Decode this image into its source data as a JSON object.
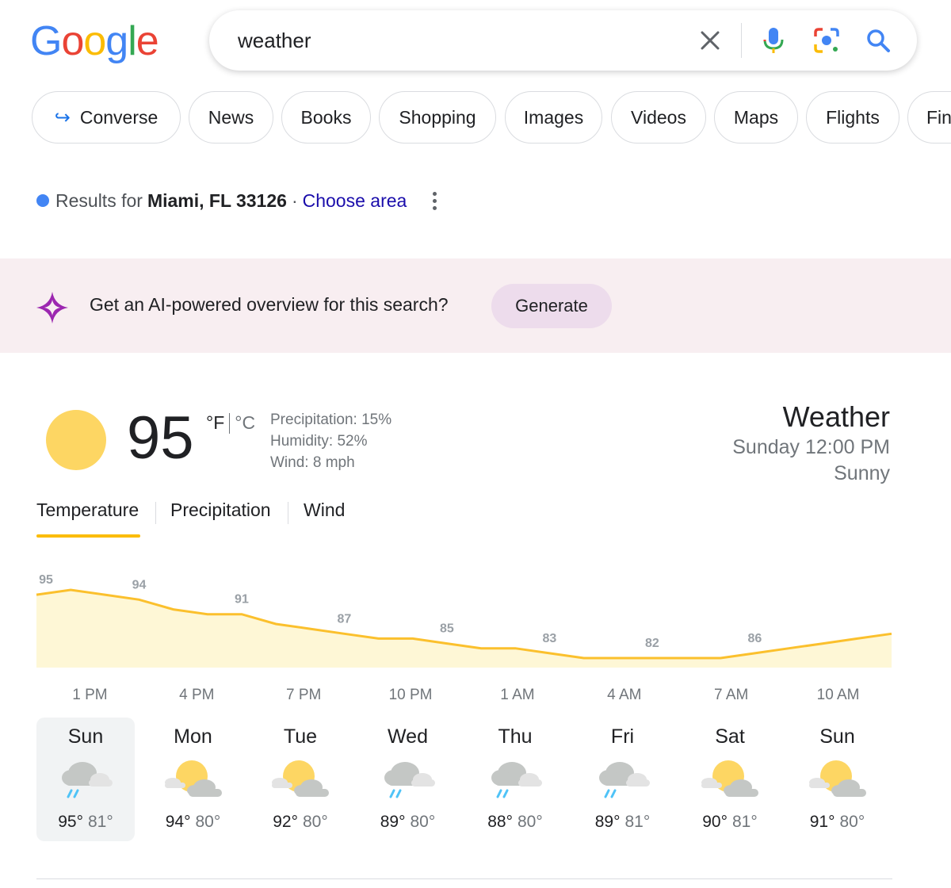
{
  "search": {
    "query": "weather"
  },
  "chips": [
    {
      "label": "Converse"
    },
    {
      "label": "News"
    },
    {
      "label": "Books"
    },
    {
      "label": "Shopping"
    },
    {
      "label": "Images"
    },
    {
      "label": "Videos"
    },
    {
      "label": "Maps"
    },
    {
      "label": "Flights"
    },
    {
      "label": "Fin"
    }
  ],
  "location": {
    "prefix": "Results for",
    "place": "Miami, FL 33126",
    "separator": "·",
    "choose": "Choose area"
  },
  "ai": {
    "prompt": "Get an AI-powered overview for this search?",
    "button": "Generate"
  },
  "weather": {
    "temp": "95",
    "unit_f": "°F",
    "unit_c": "°C",
    "precipitation": "Precipitation: 15%",
    "humidity": "Humidity: 52%",
    "wind": "Wind: 8 mph",
    "title": "Weather",
    "time": "Sunday 12:00 PM",
    "condition": "Sunny",
    "tabs": [
      "Temperature",
      "Precipitation",
      "Wind"
    ],
    "sun_color": "#fdd663",
    "accent": "#fbbc04"
  },
  "chart_data": {
    "type": "area",
    "hours": [
      "1 PM",
      "4 PM",
      "7 PM",
      "10 PM",
      "1 AM",
      "4 AM",
      "7 AM",
      "10 AM"
    ],
    "series_temps": [
      95,
      96,
      95,
      94,
      92,
      91,
      91,
      89,
      88,
      87,
      86,
      86,
      85,
      84,
      84,
      83,
      82,
      82,
      82,
      82,
      82,
      83,
      84,
      85,
      86,
      87
    ],
    "labels": [
      95,
      94,
      91,
      87,
      85,
      83,
      82,
      86
    ],
    "label_indices": [
      0,
      3,
      6,
      9,
      12,
      15,
      18,
      21
    ],
    "ylim": [
      70,
      100
    ],
    "line_color": "#fbc02d",
    "fill_color": "#fef7d6"
  },
  "days": [
    {
      "name": "Sun",
      "hi": "95°",
      "lo": "81°",
      "icon": "rain-cloud-icon",
      "selected": true
    },
    {
      "name": "Mon",
      "hi": "94°",
      "lo": "80°",
      "icon": "partly-sunny-icon"
    },
    {
      "name": "Tue",
      "hi": "92°",
      "lo": "80°",
      "icon": "partly-sunny-icon"
    },
    {
      "name": "Wed",
      "hi": "89°",
      "lo": "80°",
      "icon": "rain-cloud-icon"
    },
    {
      "name": "Thu",
      "hi": "88°",
      "lo": "80°",
      "icon": "rain-cloud-icon"
    },
    {
      "name": "Fri",
      "hi": "89°",
      "lo": "81°",
      "icon": "rain-cloud-icon"
    },
    {
      "name": "Sat",
      "hi": "90°",
      "lo": "81°",
      "icon": "partly-sunny-icon"
    },
    {
      "name": "Sun",
      "hi": "91°",
      "lo": "80°",
      "icon": "partly-sunny-icon"
    }
  ]
}
